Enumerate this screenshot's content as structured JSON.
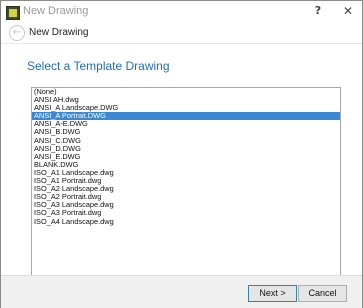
{
  "window": {
    "title": "New Drawing",
    "help_label": "?",
    "close_label": "✕"
  },
  "nav": {
    "back_glyph": "←",
    "title": "New Drawing"
  },
  "main": {
    "heading": "Select a Template Drawing",
    "templates": [
      "(None)",
      "ANSI AH.dwg",
      "ANSI_A Landscape.DWG",
      "ANSI_A Portrait.DWG",
      "ANSI_A-E.DWG",
      "ANSI_B.DWG",
      "ANSI_C.DWG",
      "ANSI_D.DWG",
      "ANSI_E.DWG",
      "BLANK.DWG",
      "ISO_A1 Landscape.dwg",
      "ISO_A1 Portrait.dwg",
      "ISO_A2 Landscape.dwg",
      "ISO_A2 Portrait.dwg",
      "ISO_A3 Landscape.dwg",
      "ISO_A3 Portrait.dwg",
      "ISO_A4 Landscape.dwg"
    ],
    "selected_template": "ANSI_A Portrait.DWG"
  },
  "footer": {
    "next_label": "Next >",
    "cancel_label": "Cancel"
  },
  "colors": {
    "heading": "#1e6fb8",
    "selection": "#3a87d4"
  }
}
